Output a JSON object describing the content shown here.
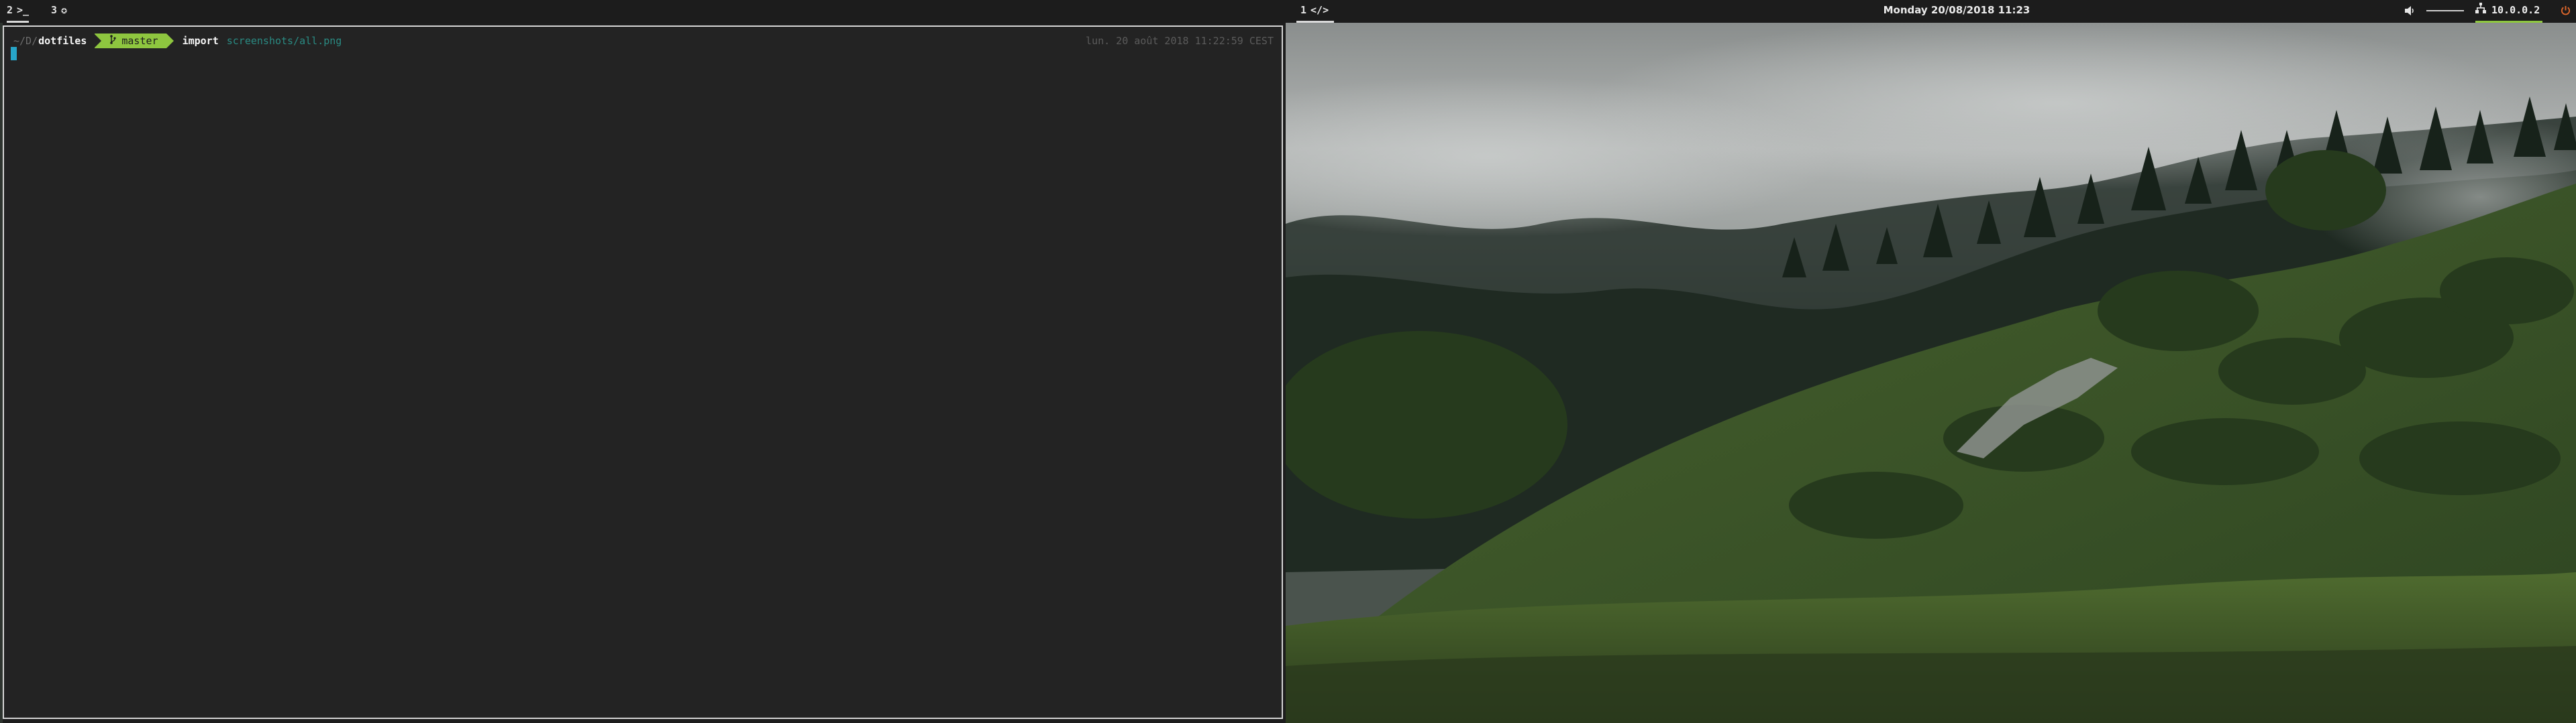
{
  "left_bar": {
    "workspaces": [
      {
        "num": "2",
        "icon": ">_",
        "icon_name": "terminal-icon",
        "active": true
      },
      {
        "num": "3",
        "icon": "✪",
        "icon_name": "globe-icon",
        "active": false
      }
    ]
  },
  "right_bar": {
    "workspaces": [
      {
        "num": "1",
        "icon": "</>",
        "icon_name": "code-icon",
        "active": true
      }
    ],
    "clock": "Monday 20/08/2018 11:23",
    "volume_level": 1.0,
    "network": "10.0.0.2"
  },
  "terminal": {
    "prompt_path_prefix": "~/D/",
    "prompt_dir": "dotfiles",
    "git_branch": "master",
    "command": "import",
    "argument": "screenshots/all.png",
    "right_prompt": "lun. 20 août 2018 11:22:59 CEST"
  },
  "colors": {
    "accent_green": "#8ec63f",
    "cursor": "#27a5c8",
    "terminal_bg": "#232323",
    "power_icon": "#e2682b"
  }
}
